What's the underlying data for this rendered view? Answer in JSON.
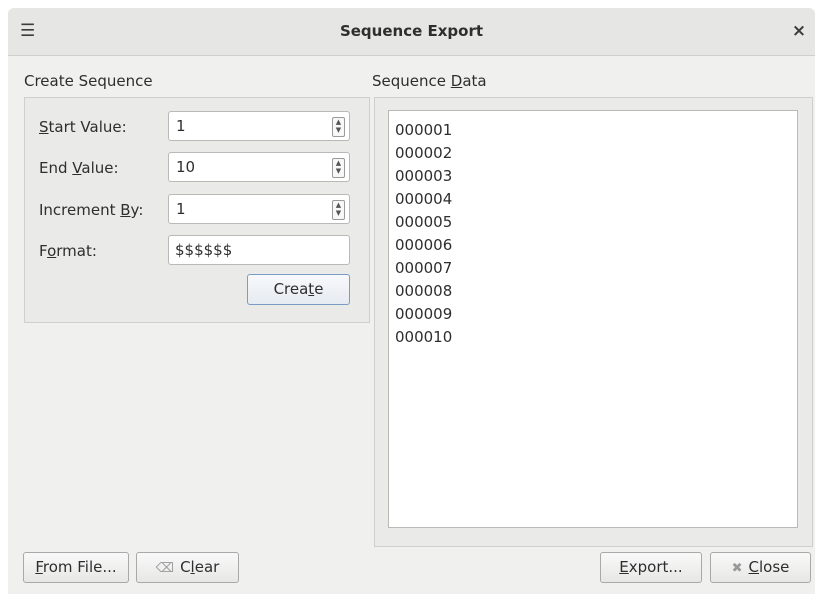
{
  "window": {
    "title": "Sequence Export",
    "menu_icon": "hamburger-menu-icon",
    "close_glyph": "×"
  },
  "create_sequence": {
    "heading": "Create Sequence",
    "start_value": {
      "label_pre": "",
      "label_mn": "S",
      "label_post": "tart Value:",
      "value": "1"
    },
    "end_value": {
      "label_pre": "End ",
      "label_mn": "V",
      "label_post": "alue:",
      "value": "10"
    },
    "increment_by": {
      "label_pre": "Increment ",
      "label_mn": "B",
      "label_post": "y:",
      "value": "1"
    },
    "format": {
      "label_pre": "F",
      "label_mn": "o",
      "label_post": "rmat:",
      "value": "$$$$$$"
    },
    "create_button": {
      "pre": "Crea",
      "mn": "t",
      "post": "e"
    }
  },
  "sequence_data": {
    "heading_pre": "Sequence ",
    "heading_mn": "D",
    "heading_post": "ata",
    "lines": [
      "000001",
      "000002",
      "000003",
      "000004",
      "000005",
      "000006",
      "000007",
      "000008",
      "000009",
      "000010"
    ]
  },
  "footer": {
    "from_file": {
      "mn": "F",
      "post": "rom File..."
    },
    "clear": {
      "pre": "C",
      "mn": "l",
      "post": "ear",
      "icon": "backspace-clear-icon"
    },
    "export": {
      "mn": "E",
      "post": "xport..."
    },
    "close": {
      "mn": "C",
      "post": "lose",
      "icon": "close-x-icon"
    }
  }
}
